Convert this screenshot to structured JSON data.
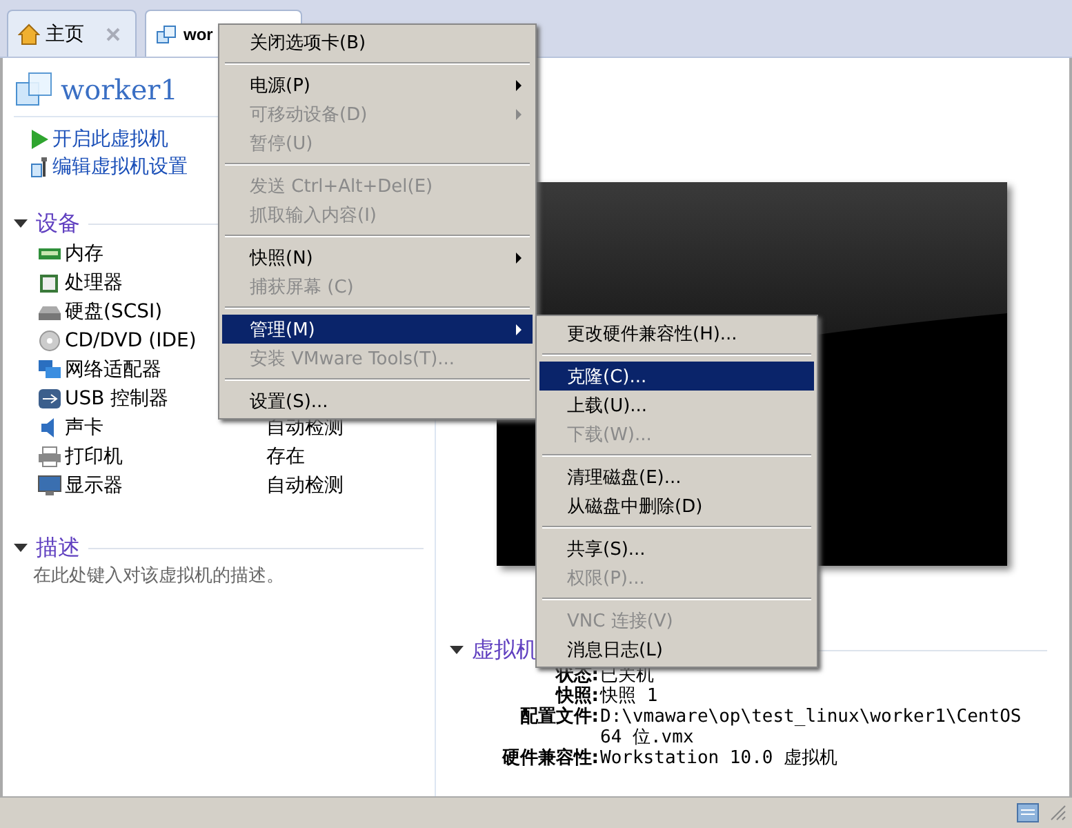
{
  "tabs": [
    {
      "label": "主页",
      "selected": false,
      "closable": true
    },
    {
      "label": "wor",
      "selected": true,
      "closable": false
    }
  ],
  "vm": {
    "name": "worker1",
    "actions": [
      "开启此虚拟机",
      "编辑虚拟机设置"
    ]
  },
  "devices": {
    "title": "设备",
    "expanded": true,
    "items": [
      {
        "name": "内存"
      },
      {
        "name": "处理器"
      },
      {
        "name": "硬盘(SCSI)"
      },
      {
        "name": "CD/DVD (IDE)"
      },
      {
        "name": "网络适配器"
      },
      {
        "name": "USB 控制器"
      },
      {
        "name": "声卡",
        "value": "自动检测"
      },
      {
        "name": "打印机",
        "value": "存在"
      },
      {
        "name": "显示器",
        "value": "自动检测"
      }
    ]
  },
  "description": {
    "title": "描述",
    "expanded": true,
    "placeholder": "在此处键入对该虚拟机的描述。"
  },
  "details": {
    "title": "虚拟机",
    "expanded": true,
    "rows": [
      {
        "label": "状态:",
        "value": "已关机"
      },
      {
        "label": "快照:",
        "value": "快照 1"
      },
      {
        "label": "配置文件:",
        "value": "D:\\vmaware\\op\\test_linux\\worker1\\CentOS 64 位.vmx"
      },
      {
        "label": "硬件兼容性:",
        "value": "Workstation 10.0 虚拟机"
      }
    ]
  },
  "menu": [
    [
      {
        "label": "关闭选项卡(B)",
        "disabled": false,
        "selected": false,
        "submenu": false
      }
    ],
    [
      {
        "label": "电源(P)",
        "disabled": false,
        "selected": false,
        "submenu": true
      },
      {
        "label": "可移动设备(D)",
        "disabled": true,
        "selected": false,
        "submenu": true
      },
      {
        "label": "暂停(U)",
        "disabled": true,
        "selected": false,
        "submenu": false
      }
    ],
    [
      {
        "label": "发送 Ctrl+Alt+Del(E)",
        "disabled": true,
        "selected": false,
        "submenu": false
      },
      {
        "label": "抓取输入内容(I)",
        "disabled": true,
        "selected": false,
        "submenu": false
      }
    ],
    [
      {
        "label": "快照(N)",
        "disabled": false,
        "selected": false,
        "submenu": true
      },
      {
        "label": "捕获屏幕 (C)",
        "disabled": true,
        "selected": false,
        "submenu": false
      }
    ],
    [
      {
        "label": "管理(M)",
        "disabled": false,
        "selected": true,
        "submenu": true
      },
      {
        "label": "安装 VMware Tools(T)...",
        "disabled": true,
        "selected": false,
        "submenu": false
      }
    ],
    [
      {
        "label": "设置(S)...",
        "disabled": false,
        "selected": false,
        "submenu": false
      }
    ]
  ],
  "submenu": [
    [
      {
        "label": "更改硬件兼容性(H)...",
        "disabled": false,
        "selected": false
      }
    ],
    [
      {
        "label": "克隆(C)...",
        "disabled": false,
        "selected": true
      },
      {
        "label": "上载(U)...",
        "disabled": false,
        "selected": false
      },
      {
        "label": "下载(W)...",
        "disabled": true,
        "selected": false
      }
    ],
    [
      {
        "label": "清理磁盘(E)...",
        "disabled": false,
        "selected": false
      },
      {
        "label": "从磁盘中删除(D)",
        "disabled": false,
        "selected": false
      }
    ],
    [
      {
        "label": "共享(S)...",
        "disabled": false,
        "selected": false
      },
      {
        "label": "权限(P)...",
        "disabled": true,
        "selected": false
      }
    ],
    [
      {
        "label": "VNC 连接(V)",
        "disabled": true,
        "selected": false
      },
      {
        "label": "消息日志(L)",
        "disabled": false,
        "selected": false
      }
    ]
  ]
}
